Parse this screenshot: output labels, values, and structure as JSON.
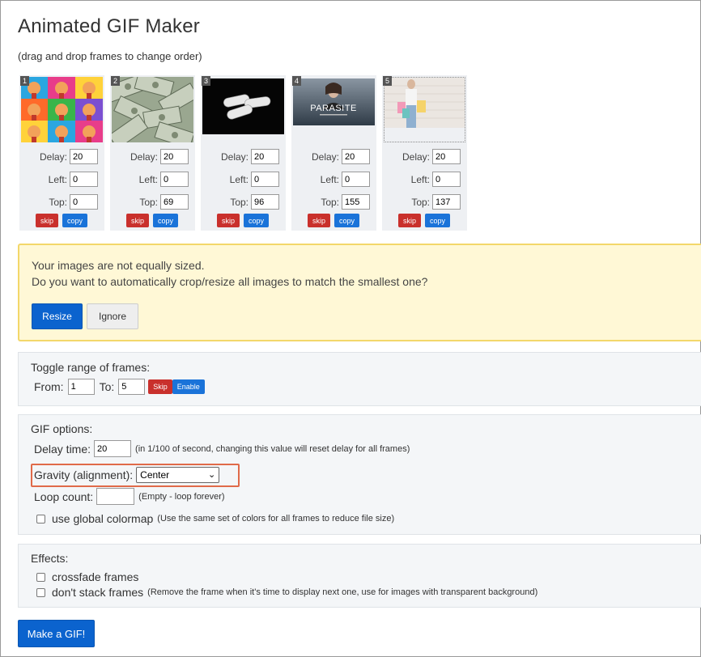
{
  "title": "Animated GIF Maker",
  "subtitle": "(drag and drop frames to change order)",
  "frame_labels": {
    "delay": "Delay:",
    "left": "Left:",
    "top": "Top:",
    "skip": "skip",
    "copy": "copy"
  },
  "frames": [
    {
      "num": "1",
      "delay": "20",
      "left": "0",
      "top": "0",
      "thumb": "pop-art-portraits-grid"
    },
    {
      "num": "2",
      "delay": "20",
      "left": "0",
      "top": "69",
      "thumb": "dollar-bills"
    },
    {
      "num": "3",
      "delay": "20",
      "left": "0",
      "top": "96",
      "thumb": "white-pills-on-black"
    },
    {
      "num": "4",
      "delay": "20",
      "left": "0",
      "top": "155",
      "thumb": "parasite-poster"
    },
    {
      "num": "5",
      "delay": "20",
      "left": "0",
      "top": "137",
      "thumb": "woman-with-shopping-bags"
    }
  ],
  "frame_thumb_text": {
    "parasite": "PARASITE"
  },
  "alert": {
    "line1": "Your images are not equally sized.",
    "line2": "Do you want to automatically crop/resize all images to match the smallest one?",
    "resize": "Resize",
    "ignore": "Ignore"
  },
  "toggle": {
    "title": "Toggle range of frames:",
    "from_label": "From:",
    "from_value": "1",
    "to_label": "To:",
    "to_value": "5",
    "skip": "Skip",
    "enable": "Enable"
  },
  "gif_options": {
    "title": "GIF options:",
    "delay_label": "Delay time:",
    "delay_value": "20",
    "delay_note": "(in 1/100 of second, changing this value will reset delay for all frames)",
    "gravity_label": "Gravity (alignment):",
    "gravity_value": "Center",
    "loop_label": "Loop count:",
    "loop_value": "",
    "loop_note": "(Empty - loop forever)",
    "colormap_label": "use global colormap",
    "colormap_note": "(Use the same set of colors for all frames to reduce file size)"
  },
  "effects": {
    "title": "Effects:",
    "crossfade": "crossfade frames",
    "nostack": "don't stack frames",
    "nostack_note": "(Remove the frame when it's time to display next one, use for images with transparent background)"
  },
  "make_button": "Make a GIF!",
  "colors": {
    "primary": "#0b63ce",
    "danger": "#c9302c",
    "warning_bg": "#fff8d6",
    "highlight": "#e06a49"
  }
}
